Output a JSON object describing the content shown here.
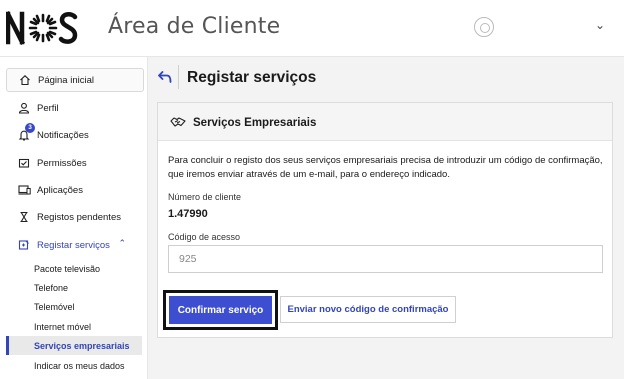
{
  "header": {
    "logo_text": "NOS",
    "app_title": "Área de Cliente"
  },
  "sidebar": {
    "items": [
      {
        "label": "Página inicial",
        "icon": "home-icon"
      },
      {
        "label": "Perfil",
        "icon": "user-icon"
      },
      {
        "label": "Notificações",
        "icon": "bell-icon",
        "badge": "3"
      },
      {
        "label": "Permissões",
        "icon": "permissions-icon"
      },
      {
        "label": "Aplicações",
        "icon": "devices-icon"
      },
      {
        "label": "Registos pendentes",
        "icon": "hourglass-icon"
      },
      {
        "label": "Registar serviços",
        "icon": "register-icon",
        "expanded": true
      }
    ],
    "sub_items": [
      {
        "label": "Pacote televisão"
      },
      {
        "label": "Telefone"
      },
      {
        "label": "Telemóvel"
      },
      {
        "label": "Internet móvel"
      },
      {
        "label": "Serviços empresariais",
        "selected": true
      },
      {
        "label": "Indicar os meus dados"
      }
    ]
  },
  "main": {
    "page_title": "Registar serviços",
    "card": {
      "title": "Serviços Empresariais",
      "description": "Para concluir o registo dos seus serviços empresariais precisa de introduzir um código de confirmação, que iremos enviar através de um e-mail, para o endereço indicado.",
      "client_number_label": "Número de cliente",
      "client_number_value": "1.47990",
      "access_code_label": "Código de acesso",
      "access_code_value": "925",
      "confirm_button": "Confirmar serviço",
      "resend_button": "Enviar novo código de confirmação"
    }
  },
  "colors": {
    "accent": "#3d4fd0",
    "link": "#3345b8"
  }
}
